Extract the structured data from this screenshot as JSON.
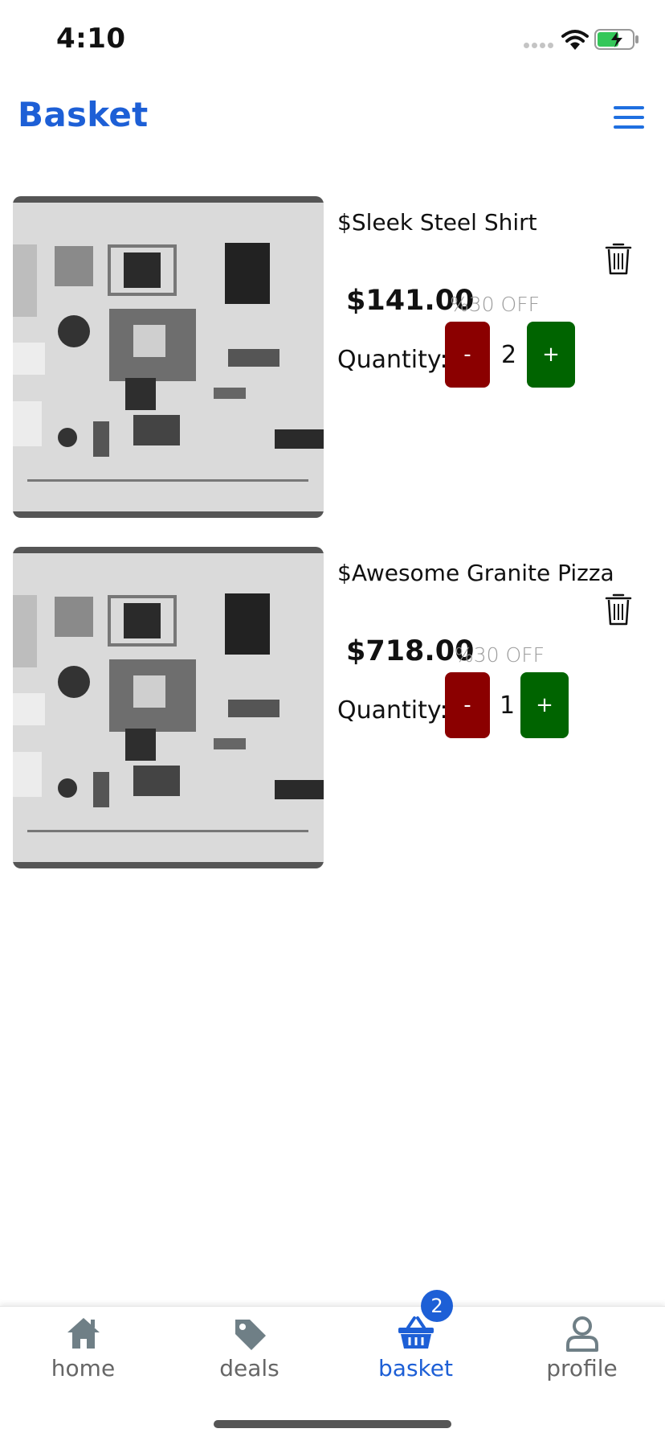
{
  "status_bar": {
    "time": "4:10"
  },
  "header": {
    "title": "Basket"
  },
  "cart": {
    "items": [
      {
        "name": "$Sleek Steel Shirt",
        "price": "$141.00",
        "discount": "%30 OFF",
        "quantity_label": "Quantity:",
        "quantity": "2",
        "minus_label": "-",
        "plus_label": "+"
      },
      {
        "name": "$Awesome Granite Pizza",
        "price": "$718.00",
        "discount": "%30 OFF",
        "quantity_label": "Quantity:",
        "quantity": "1",
        "minus_label": "-",
        "plus_label": "+"
      }
    ]
  },
  "tab_bar": {
    "tabs": [
      {
        "label": "home",
        "icon": "home-icon"
      },
      {
        "label": "deals",
        "icon": "tag-icon"
      },
      {
        "label": "basket",
        "icon": "basket-icon",
        "badge": "2"
      },
      {
        "label": "profile",
        "icon": "profile-icon"
      }
    ],
    "active": "basket"
  },
  "colors": {
    "accent": "#1d5fd6",
    "minus_button": "#8b0000",
    "plus_button": "#006400",
    "discount_text": "#9c9c9c"
  }
}
